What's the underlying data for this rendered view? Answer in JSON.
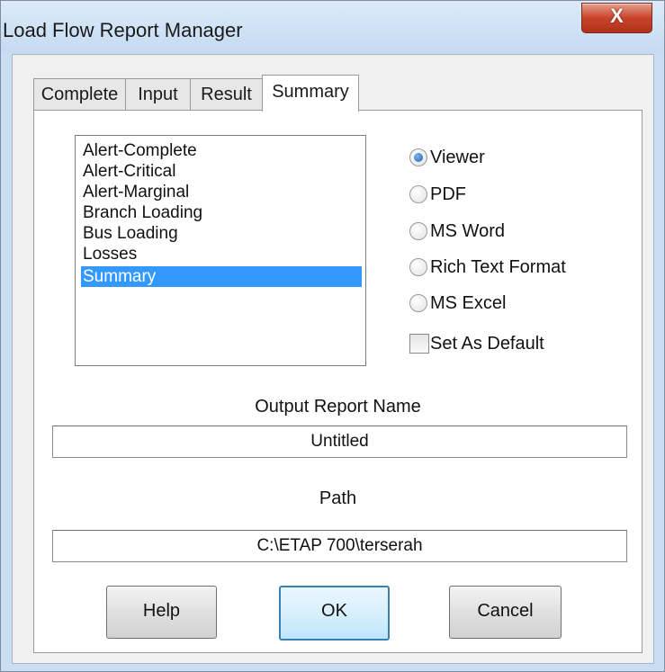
{
  "window": {
    "title": "Load Flow Report Manager",
    "close_glyph": "X"
  },
  "tabs": [
    {
      "label": "Complete"
    },
    {
      "label": "Input"
    },
    {
      "label": "Result"
    },
    {
      "label": "Summary",
      "active": true
    }
  ],
  "report_list": {
    "items": [
      "Alert-Complete",
      "Alert-Critical",
      "Alert-Marginal",
      "Branch Loading",
      "Bus Loading",
      "Losses",
      "Summary"
    ],
    "selected": "Summary"
  },
  "format_options": {
    "items": [
      "Viewer",
      "PDF",
      "MS Word",
      "Rich Text Format",
      "MS Excel"
    ],
    "selected": "Viewer"
  },
  "default_checkbox": {
    "label": "Set As Default",
    "checked": false
  },
  "output": {
    "report_name_label": "Output Report Name",
    "report_name_value": "Untitled",
    "path_label": "Path",
    "path_value": "C:\\ETAP 700\\terserah"
  },
  "buttons": {
    "help": "Help",
    "ok": "OK",
    "cancel": "Cancel"
  },
  "colors": {
    "selection": "#3399ff",
    "close_button": "#c7432b",
    "titlebar": "#c9def3"
  },
  "icons": {
    "close": "close-icon"
  }
}
